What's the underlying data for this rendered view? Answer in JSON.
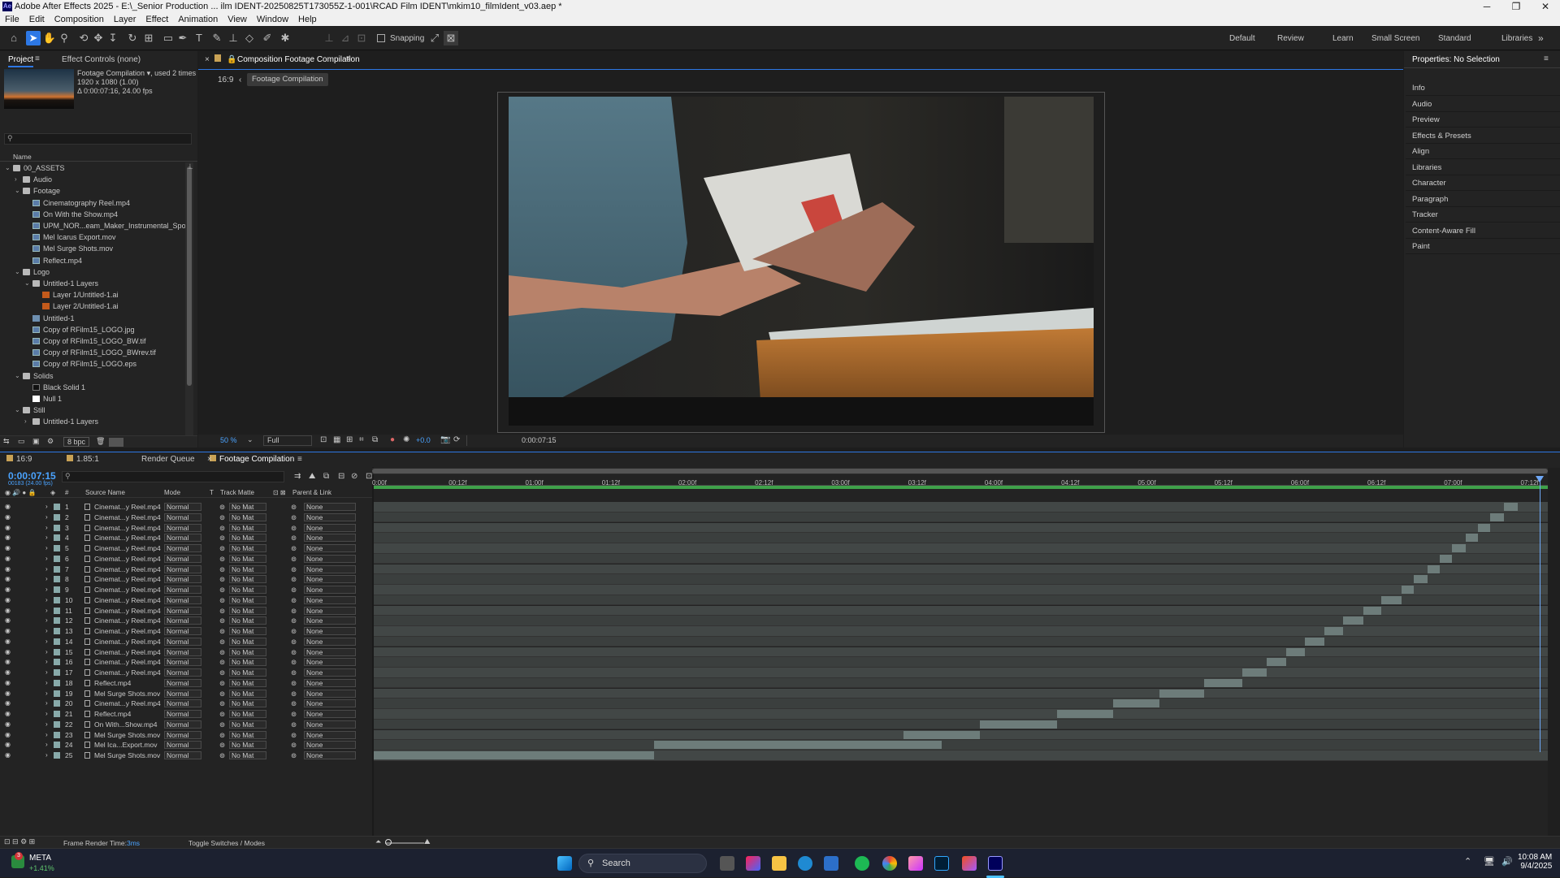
{
  "window": {
    "title": "Adobe After Effects 2025 - E:\\_Senior Production ... ilm IDENT-20250825T173055Z-1-001\\RCAD Film IDENT\\mkim10_filmIdent_v03.aep *",
    "logo": "Ae"
  },
  "menu": [
    "File",
    "Edit",
    "Composition",
    "Layer",
    "Effect",
    "Animation",
    "View",
    "Window",
    "Help"
  ],
  "toolbar": {
    "snapping_label": "Snapping",
    "workspaces": [
      "Default",
      "Review",
      "Learn",
      "Small Screen",
      "Standard",
      "Libraries"
    ],
    "more": "»"
  },
  "project": {
    "tab_project": "Project",
    "tab_effects": "Effect Controls (none)",
    "item_name": "Footage Compilation",
    "item_used": ", used 2 times",
    "item_dims": "1920 x 1080 (1.00)",
    "item_duration": "Δ 0:00:07:16, 24.00 fps",
    "search_placeholder": "",
    "col_name": "Name",
    "bpc": "8 bpc",
    "tree": [
      {
        "label": "00_ASSETS",
        "indent": 0,
        "type": "folder",
        "twirl": "open"
      },
      {
        "label": "Audio",
        "indent": 1,
        "type": "folder",
        "twirl": "closed"
      },
      {
        "label": "Footage",
        "indent": 1,
        "type": "folder",
        "twirl": "open"
      },
      {
        "label": "Cinematography Reel.mp4",
        "indent": 2,
        "type": "file",
        "twirl": ""
      },
      {
        "label": "On With the Show.mp4",
        "indent": 2,
        "type": "file",
        "twirl": ""
      },
      {
        "label": "UPM_NOR...eam_Maker_Instrumental_Spoof_2",
        "indent": 2,
        "type": "file",
        "twirl": ""
      },
      {
        "label": "Mel Icarus Export.mov",
        "indent": 2,
        "type": "file",
        "twirl": ""
      },
      {
        "label": "Mel Surge Shots.mov",
        "indent": 2,
        "type": "file",
        "twirl": ""
      },
      {
        "label": "Reflect.mp4",
        "indent": 2,
        "type": "file",
        "twirl": ""
      },
      {
        "label": "Logo",
        "indent": 1,
        "type": "folder",
        "twirl": "open"
      },
      {
        "label": "Untitled-1 Layers",
        "indent": 2,
        "type": "folder",
        "twirl": "open"
      },
      {
        "label": "Layer 1/Untitled-1.ai",
        "indent": 3,
        "type": "ai",
        "twirl": ""
      },
      {
        "label": "Layer 2/Untitled-1.ai",
        "indent": 3,
        "type": "ai",
        "twirl": ""
      },
      {
        "label": "Untitled-1",
        "indent": 2,
        "type": "comp",
        "twirl": ""
      },
      {
        "label": "Copy of RFilm15_LOGO.jpg",
        "indent": 2,
        "type": "file",
        "twirl": ""
      },
      {
        "label": "Copy of RFilm15_LOGO_BW.tif",
        "indent": 2,
        "type": "file",
        "twirl": ""
      },
      {
        "label": "Copy of RFilm15_LOGO_BWrev.tif",
        "indent": 2,
        "type": "file",
        "twirl": ""
      },
      {
        "label": "Copy of RFilm15_LOGO.eps",
        "indent": 2,
        "type": "file",
        "twirl": ""
      },
      {
        "label": "Solids",
        "indent": 1,
        "type": "folder",
        "twirl": "open"
      },
      {
        "label": "Black Solid 1",
        "indent": 2,
        "type": "solid black",
        "twirl": ""
      },
      {
        "label": "Null 1",
        "indent": 2,
        "type": "solid",
        "twirl": ""
      },
      {
        "label": "Still",
        "indent": 1,
        "type": "folder",
        "twirl": "open"
      },
      {
        "label": "Untitled-1 Layers",
        "indent": 2,
        "type": "folder",
        "twirl": "closed"
      }
    ]
  },
  "comp": {
    "tab_title": "Composition Footage Compilation",
    "aspect": "16:9",
    "crumb": "Footage Compilation",
    "zoom": "50 %",
    "resolution": "Full",
    "exposure": "+0.0",
    "timecode": "0:00:07:15"
  },
  "properties": {
    "title": "Properties: No Selection",
    "items": [
      "Info",
      "Audio",
      "Preview",
      "Effects & Presets",
      "Align",
      "Libraries",
      "Character",
      "Paragraph",
      "Tracker",
      "Content-Aware Fill",
      "Paint"
    ]
  },
  "timeline": {
    "tabs": [
      "16:9",
      "1.85:1",
      "Render Queue",
      "Footage Compilation"
    ],
    "timecode": "0:00:07:15",
    "frames": "00183 (24.00 fps)",
    "col_source": "Source Name",
    "col_mode": "Mode",
    "col_t": "T",
    "col_track": "Track Matte",
    "col_parent": "Parent & Link",
    "col_num": "#",
    "ruler": [
      "0:00f",
      "00:12f",
      "01:00f",
      "01:12f",
      "02:00f",
      "02:12f",
      "03:00f",
      "03:12f",
      "04:00f",
      "04:12f",
      "05:00f",
      "05:12f",
      "06:00f",
      "06:12f",
      "07:00f",
      "07:12f"
    ],
    "footer_render_label": "Frame Render Time:",
    "footer_render_value": "3ms",
    "footer_toggle": "Toggle Switches / Modes",
    "layers": [
      {
        "n": "1",
        "name": "Cinemat...y Reel.mp4",
        "mode": "Normal",
        "matte": "No Mat",
        "parent": "None",
        "in": 7.38,
        "out": 7.47
      },
      {
        "n": "2",
        "name": "Cinemat...y Reel.mp4",
        "mode": "Normal",
        "matte": "No Mat",
        "parent": "None",
        "in": 7.29,
        "out": 7.38
      },
      {
        "n": "3",
        "name": "Cinemat...y Reel.mp4",
        "mode": "Normal",
        "matte": "No Mat",
        "parent": "None",
        "in": 7.21,
        "out": 7.29
      },
      {
        "n": "4",
        "name": "Cinemat...y Reel.mp4",
        "mode": "Normal",
        "matte": "No Mat",
        "parent": "None",
        "in": 7.13,
        "out": 7.21
      },
      {
        "n": "5",
        "name": "Cinemat...y Reel.mp4",
        "mode": "Normal",
        "matte": "No Mat",
        "parent": "None",
        "in": 7.04,
        "out": 7.13
      },
      {
        "n": "6",
        "name": "Cinemat...y Reel.mp4",
        "mode": "Normal",
        "matte": "No Mat",
        "parent": "None",
        "in": 6.96,
        "out": 7.04
      },
      {
        "n": "7",
        "name": "Cinemat...y Reel.mp4",
        "mode": "Normal",
        "matte": "No Mat",
        "parent": "None",
        "in": 6.88,
        "out": 6.96
      },
      {
        "n": "8",
        "name": "Cinemat...y Reel.mp4",
        "mode": "Normal",
        "matte": "No Mat",
        "parent": "None",
        "in": 6.79,
        "out": 6.88
      },
      {
        "n": "9",
        "name": "Cinemat...y Reel.mp4",
        "mode": "Normal",
        "matte": "No Mat",
        "parent": "None",
        "in": 6.71,
        "out": 6.79
      },
      {
        "n": "10",
        "name": "Cinemat...y Reel.mp4",
        "mode": "Normal",
        "matte": "No Mat",
        "parent": "None",
        "in": 6.58,
        "out": 6.71
      },
      {
        "n": "11",
        "name": "Cinemat...y Reel.mp4",
        "mode": "Normal",
        "matte": "No Mat",
        "parent": "None",
        "in": 6.46,
        "out": 6.58
      },
      {
        "n": "12",
        "name": "Cinemat...y Reel.mp4",
        "mode": "Normal",
        "matte": "No Mat",
        "parent": "None",
        "in": 6.33,
        "out": 6.46
      },
      {
        "n": "13",
        "name": "Cinemat...y Reel.mp4",
        "mode": "Normal",
        "matte": "No Mat",
        "parent": "None",
        "in": 6.21,
        "out": 6.33
      },
      {
        "n": "14",
        "name": "Cinemat...y Reel.mp4",
        "mode": "Normal",
        "matte": "No Mat",
        "parent": "None",
        "in": 6.08,
        "out": 6.21
      },
      {
        "n": "15",
        "name": "Cinemat...y Reel.mp4",
        "mode": "Normal",
        "matte": "No Mat",
        "parent": "None",
        "in": 5.96,
        "out": 6.08
      },
      {
        "n": "16",
        "name": "Cinemat...y Reel.mp4",
        "mode": "Normal",
        "matte": "No Mat",
        "parent": "None",
        "in": 5.83,
        "out": 5.96
      },
      {
        "n": "17",
        "name": "Cinemat...y Reel.mp4",
        "mode": "Normal",
        "matte": "No Mat",
        "parent": "None",
        "in": 5.67,
        "out": 5.83
      },
      {
        "n": "18",
        "name": "Reflect.mp4",
        "mode": "Normal",
        "matte": "No Mat",
        "parent": "None",
        "in": 5.42,
        "out": 5.67
      },
      {
        "n": "19",
        "name": "Mel Surge Shots.mov",
        "mode": "Normal",
        "matte": "No Mat",
        "parent": "None",
        "in": 5.13,
        "out": 5.42
      },
      {
        "n": "20",
        "name": "Cinemat...y Reel.mp4",
        "mode": "Normal",
        "matte": "No Mat",
        "parent": "None",
        "in": 4.83,
        "out": 5.13
      },
      {
        "n": "21",
        "name": "Reflect.mp4",
        "mode": "Normal",
        "matte": "No Mat",
        "parent": "None",
        "in": 4.46,
        "out": 4.83
      },
      {
        "n": "22",
        "name": "On With...Show.mp4",
        "mode": "Normal",
        "matte": "No Mat",
        "parent": "None",
        "in": 3.96,
        "out": 4.46
      },
      {
        "n": "23",
        "name": "Mel Surge Shots.mov",
        "mode": "Normal",
        "matte": "No Mat",
        "parent": "None",
        "in": 3.46,
        "out": 3.96
      },
      {
        "n": "24",
        "name": "Mel Ica...Export.mov",
        "mode": "Normal",
        "matte": "No Mat",
        "parent": "None",
        "in": 1.83,
        "out": 3.71
      },
      {
        "n": "25",
        "name": "Mel Surge Shots.mov",
        "mode": "Normal",
        "matte": "No Mat",
        "parent": "None",
        "in": 0.0,
        "out": 1.83
      }
    ]
  },
  "taskbar": {
    "stock_name": "META",
    "stock_change": "+1.41%",
    "badge": "3",
    "search": "Search",
    "time": "10:08 AM",
    "date": "9/4/2025"
  },
  "colors": {
    "accent": "#2d78e5",
    "timecode": "#4aa3ff",
    "playhead": "#6ea8f7",
    "layer_bar": "#6d7c7a",
    "work_area": "#3fa14a"
  }
}
